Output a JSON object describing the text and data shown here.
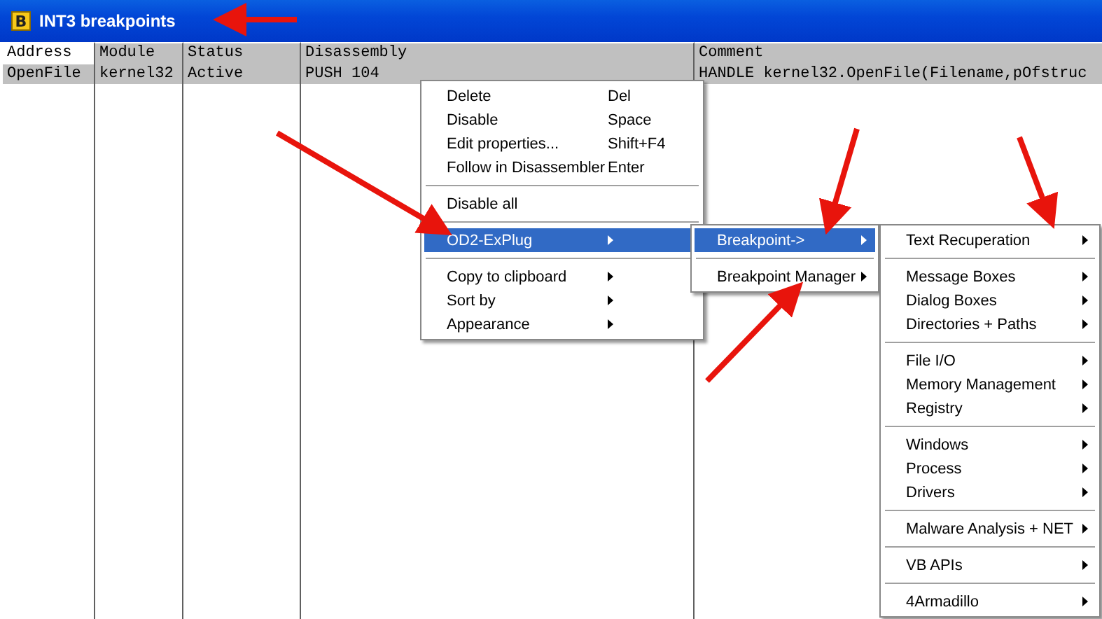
{
  "window": {
    "icon_letter": "B",
    "title": "INT3 breakpoints"
  },
  "table": {
    "columns": [
      {
        "label": "Address",
        "selected": true
      },
      {
        "label": "Module",
        "selected": false
      },
      {
        "label": "Status",
        "selected": false
      },
      {
        "label": "Disassembly",
        "selected": false
      },
      {
        "label": "Comment",
        "selected": false
      }
    ],
    "rows": [
      {
        "selected": true,
        "cells": [
          "OpenFile",
          "kernel32",
          "Active",
          "PUSH 104",
          "HANDLE kernel32.OpenFile(Filename,pOfstruc"
        ]
      }
    ]
  },
  "menus": [
    {
      "items": [
        {
          "kind": "item",
          "label": "Delete",
          "shortcut": "Del",
          "submenu": false,
          "selected": false
        },
        {
          "kind": "item",
          "label": "Disable",
          "shortcut": "Space",
          "submenu": false,
          "selected": false
        },
        {
          "kind": "item",
          "label": "Edit properties...",
          "shortcut": "Shift+F4",
          "submenu": false,
          "selected": false
        },
        {
          "kind": "item",
          "label": "Follow in Disassembler",
          "shortcut": "Enter",
          "submenu": false,
          "selected": false
        },
        {
          "kind": "separator"
        },
        {
          "kind": "item",
          "label": "Disable all",
          "submenu": false,
          "selected": false
        },
        {
          "kind": "separator"
        },
        {
          "kind": "item",
          "label": "OD2-ExPlug",
          "submenu": true,
          "selected": true
        },
        {
          "kind": "separator"
        },
        {
          "kind": "item",
          "label": "Copy to clipboard",
          "submenu": true,
          "selected": false
        },
        {
          "kind": "item",
          "label": "Sort by",
          "submenu": true,
          "selected": false
        },
        {
          "kind": "item",
          "label": "Appearance",
          "submenu": true,
          "selected": false
        }
      ]
    },
    {
      "items": [
        {
          "kind": "item",
          "label": "Breakpoint->",
          "submenu": true,
          "selected": true
        },
        {
          "kind": "separator"
        },
        {
          "kind": "item",
          "label": "Breakpoint Manager",
          "submenu": true,
          "selected": false
        }
      ]
    },
    {
      "items": [
        {
          "kind": "item",
          "label": "Text Recuperation",
          "submenu": true,
          "selected": false
        },
        {
          "kind": "separator"
        },
        {
          "kind": "item",
          "label": "Message Boxes",
          "submenu": true,
          "selected": false
        },
        {
          "kind": "item",
          "label": "Dialog Boxes",
          "submenu": true,
          "selected": false
        },
        {
          "kind": "item",
          "label": "Directories + Paths",
          "submenu": true,
          "selected": false
        },
        {
          "kind": "separator"
        },
        {
          "kind": "item",
          "label": "File I/O",
          "submenu": true,
          "selected": false
        },
        {
          "kind": "item",
          "label": "Memory Management",
          "submenu": true,
          "selected": false
        },
        {
          "kind": "item",
          "label": "Registry",
          "submenu": true,
          "selected": false
        },
        {
          "kind": "separator"
        },
        {
          "kind": "item",
          "label": "Windows",
          "submenu": true,
          "selected": false
        },
        {
          "kind": "item",
          "label": "Process",
          "submenu": true,
          "selected": false
        },
        {
          "kind": "item",
          "label": "Drivers",
          "submenu": true,
          "selected": false
        },
        {
          "kind": "separator"
        },
        {
          "kind": "item",
          "label": "Malware Analysis + NET",
          "submenu": true,
          "selected": false
        },
        {
          "kind": "separator"
        },
        {
          "kind": "item",
          "label": "VB APIs",
          "submenu": true,
          "selected": false
        },
        {
          "kind": "separator"
        },
        {
          "kind": "item",
          "label": "4Armadillo",
          "submenu": true,
          "selected": false
        }
      ]
    }
  ]
}
